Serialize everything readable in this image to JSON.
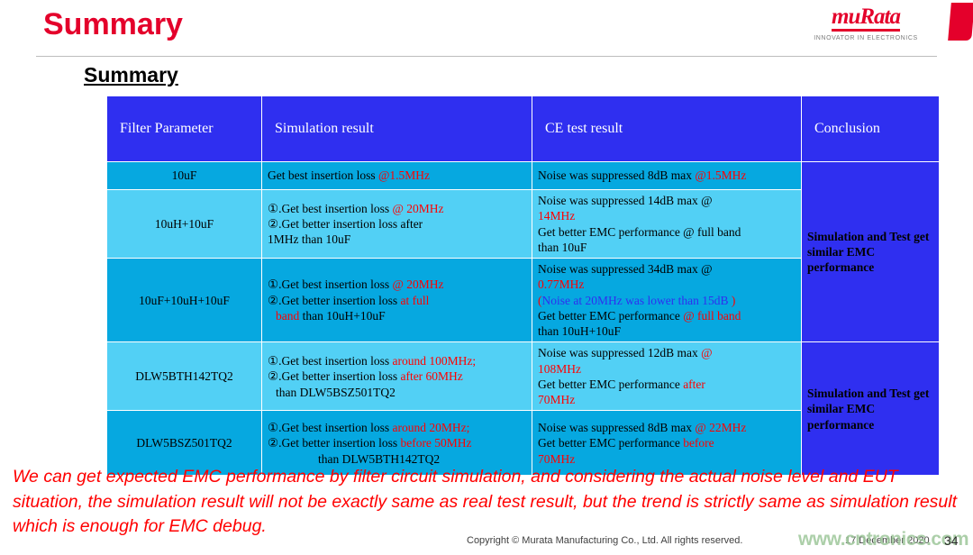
{
  "header": {
    "title": "Summary",
    "title_color": "#e4002b",
    "logo_word": "muRata",
    "logo_tagline": "INNOVATOR IN ELECTRONICS"
  },
  "sub_heading": "Summary",
  "table": {
    "accent_header_color": "#2f2ff0",
    "row_color_a": "#06a8e0",
    "row_color_b": "#52d0f5",
    "columns": [
      "Filter Parameter",
      "Simulation result",
      "CE test result",
      "Conclusion"
    ],
    "rows": [
      {
        "param": "10uF",
        "sim": {
          "l1_black": "Get best insertion loss ",
          "l1_red": "@1.5MHz"
        },
        "ce": {
          "l1_black": "Noise was suppressed 8dB max ",
          "l1_red": "@1.5MHz"
        }
      },
      {
        "param": "10uH+10uF",
        "sim": {
          "l1_black": "①.Get best insertion loss ",
          "l1_red": "@ 20MHz",
          "l2_black": "②.Get better insertion loss after",
          "l3_black": "1MHz than 10uF"
        },
        "ce": {
          "l1_black": "Noise was suppressed 14dB max @",
          "l2_red": "14MHz",
          "l3_black": "Get better EMC performance @ full band",
          "l4_black": "than  10uF"
        }
      },
      {
        "param": "10uF+10uH+10uF",
        "sim": {
          "l1_black": "①.Get best insertion loss ",
          "l1_red": "@ 20MHz",
          "l2_black": "②.Get better insertion loss ",
          "l2_red": "at full",
          "l3_red": "band",
          "l3_black": " than 10uH+10uF"
        },
        "ce": {
          "l1_black": "Noise was suppressed 34dB max @",
          "l2_red": "0.77MHz",
          "l3_paren_open": "(",
          "l3_blue": "Noise at 20MHz was lower than 15dB",
          "l3_paren_close": " )",
          "l4_black": "Get better EMC performance ",
          "l4_red": "@ full band",
          "l5_black": "than  10uH+10uF"
        }
      },
      {
        "param": "DLW5BTH142TQ2",
        "sim": {
          "l1_black": "①.Get best insertion loss ",
          "l1_red": "around 100MHz;",
          "l2_black": "②.Get better insertion loss ",
          "l2_red": "after 60MHz",
          "l3_black": " than DLW5BSZ501TQ2"
        },
        "ce": {
          "l1_black": "Noise was suppressed 12dB max ",
          "l1_red": "@",
          "l2_red": "108MHz",
          "l3_black": "Get better EMC performance ",
          "l3_red": "after",
          "l4_red": "70MHz"
        }
      },
      {
        "param": "DLW5BSZ501TQ2",
        "sim": {
          "l1_black": "①.Get best insertion loss ",
          "l1_red": "around 20MHz;",
          "l2_black": "②.Get better insertion loss ",
          "l2_red": "before 50MHz",
          "l3_black": "than DLW5BTH142TQ2"
        },
        "ce": {
          "l1_black": "Noise was suppressed 8dB max ",
          "l1_red": "@ 22MHz",
          "l2_black": "Get better EMC performance ",
          "l2_red": "before",
          "l3_red": "70MHz"
        }
      }
    ],
    "conclusions": [
      "Simulation and Test get similar EMC performance",
      "Simulation and Test get similar EMC performance"
    ]
  },
  "bottom_note": "We can get expected EMC performance by filter circuit simulation, and considering the actual noise level and EUT situation, the simulation result will not be exactly same as real test result, but the trend is strictly same as simulation result which is enough for EMC debug.",
  "footer": {
    "copyright": "Copyright © Murata Manufacturing Co., Ltd. All rights reserved.",
    "date": "17 December 2020",
    "page_number": "34",
    "watermark": "www.cntronics.com"
  }
}
